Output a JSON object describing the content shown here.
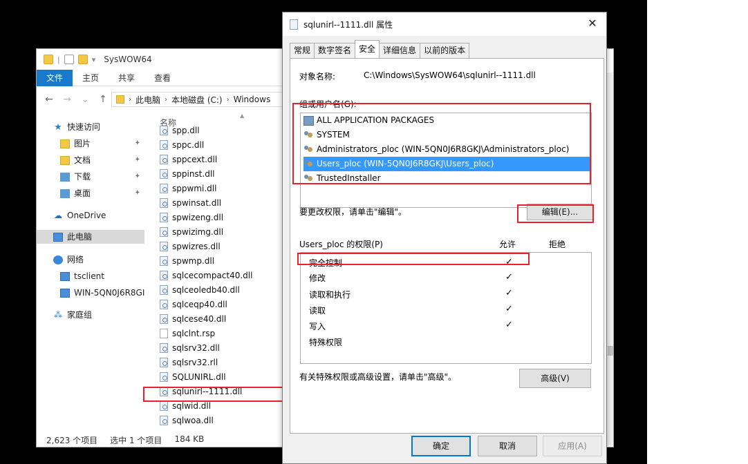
{
  "explorer": {
    "title": "SysWOW64",
    "ribbon_tabs": [
      "文件",
      "主页",
      "共享",
      "查看"
    ],
    "path": [
      "此电脑",
      "本地磁盘 (C:)",
      "Windows"
    ],
    "nav": {
      "quick_access": "快速访问",
      "pictures": "图片",
      "documents": "文档",
      "downloads": "下载",
      "desktop": "桌面",
      "onedrive": "OneDrive",
      "this_pc": "此电脑",
      "network": "网络",
      "tsclient": "tsclient",
      "win_host": "WIN-5QN0J6R8GI",
      "homegroup": "家庭组"
    },
    "column_name": "名称",
    "files": [
      "spp.dll",
      "sppc.dll",
      "sppcext.dll",
      "sppinst.dll",
      "sppwmi.dll",
      "spwinsat.dll",
      "spwizeng.dll",
      "spwizimg.dll",
      "spwizres.dll",
      "spwmp.dll",
      "sqlcecompact40.dll",
      "sqlceoledb40.dll",
      "sqlceqp40.dll",
      "sqlcese40.dll",
      "sqlclnt.rsp",
      "sqlsrv32.dll",
      "sqlsrv32.rll",
      "SQLUNIRL.dll",
      "sqlunirl--1111.dll",
      "sqlwid.dll",
      "sqlwoa.dll"
    ],
    "status": {
      "count": "2,623 个项目",
      "selected": "选中 1 个项目",
      "size": "184 KB"
    }
  },
  "dialog": {
    "title": "sqlunirl--1111.dll 属性",
    "close": "✕",
    "tabs": [
      "常规",
      "数字签名",
      "安全",
      "详细信息",
      "以前的版本"
    ],
    "object_name_label": "对象名称:",
    "object_name_value": "C:\\Windows\\SysWOW64\\sqlunirl--1111.dll",
    "groups_label": "组或用户名(G):",
    "groups": [
      "ALL APPLICATION PACKAGES",
      "SYSTEM",
      "Administrators_ploc (WIN-5QN0J6R8GKJ\\Administrators_ploc)",
      "Users_ploc (WIN-5QN0J6R8GKJ\\Users_ploc)",
      "TrustedInstaller"
    ],
    "change_text": "要更改权限，请单击\"编辑\"。",
    "edit_button": "编辑(E)...",
    "perm_label": "Users_ploc 的权限(P)",
    "allow_label": "允许",
    "deny_label": "拒绝",
    "permissions": [
      "完全控制",
      "修改",
      "读取和执行",
      "读取",
      "写入",
      "特殊权限"
    ],
    "allowed_mark": "✓",
    "advanced_text": "有关特殊权限或高级设置，请单击\"高级\"。",
    "advanced_button": "高级(V)",
    "ok_button": "确定",
    "cancel_button": "取消",
    "apply_button": "应用(A)"
  },
  "colors": {
    "accent": "#1979ca",
    "selection": "#3399ff",
    "annotation": "#e8212d"
  }
}
